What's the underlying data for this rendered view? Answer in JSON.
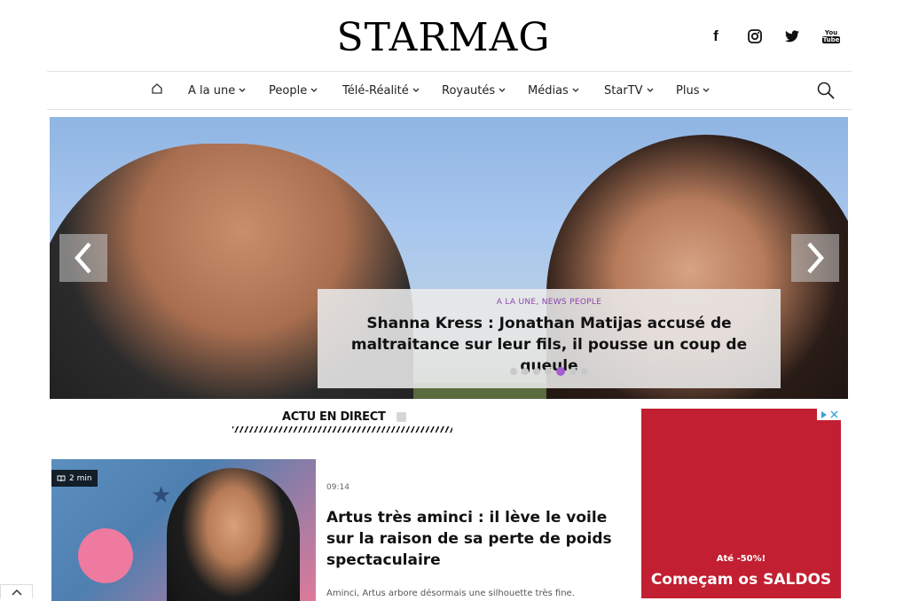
{
  "header": {
    "logo": "STARMAG",
    "social": [
      {
        "icon": "facebook-icon",
        "glyph": "f"
      },
      {
        "icon": "instagram-icon"
      },
      {
        "icon": "twitter-icon"
      },
      {
        "icon": "youtube-icon",
        "glyph_top": "You",
        "glyph_bottom": "Tube"
      }
    ]
  },
  "nav": {
    "home_icon": "home-icon",
    "items": [
      {
        "label": "A la une"
      },
      {
        "label": "People"
      },
      {
        "label": "Télé-Réalité"
      },
      {
        "label": "Royautés"
      },
      {
        "label": "Médias"
      },
      {
        "label": "StarTV"
      },
      {
        "label": "Plus"
      }
    ],
    "search_icon": "search-icon"
  },
  "hero": {
    "category": "A LA UNE, NEWS PEOPLE",
    "title": "Shanna Kress : Jonathan Matijas accusé de maltraitance sur leur fils, il pousse un coup de gueule",
    "slide_count": 7,
    "active_slide": 5
  },
  "live": {
    "heading": "ACTU EN DIRECT"
  },
  "article": {
    "read_time": "2 min",
    "time": "09:14",
    "title": "Artus très aminci : il lève le voile sur la raison de sa perte de poids spectaculaire",
    "excerpt": "Aminci, Artus arbore désormais une silhouette très fine."
  },
  "ad": {
    "subline": "Até -50%!",
    "headline": "Começam os SALDOS",
    "background": "#c21f32"
  },
  "colors": {
    "accent": "#a35fd1",
    "category": "#8e44ad"
  }
}
